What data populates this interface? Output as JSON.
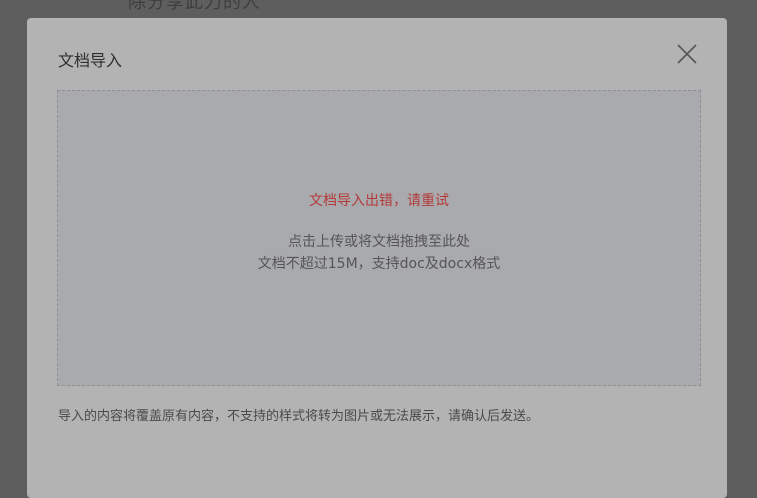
{
  "background": {
    "partial_text": "除分享此力的人"
  },
  "modal": {
    "title": "文档导入",
    "close_icon": "close-icon",
    "dropzone": {
      "error_message": "文档导入出错，请重试",
      "hint_line_1": "点击上传或将文档拖拽至此处",
      "hint_line_2": "文档不超过15M，支持doc及docx格式"
    },
    "notice": "导入的内容将覆盖原有内容，不支持的样式将转为图片或无法展示，请确认后发送。"
  },
  "colors": {
    "overlay": "#5e5e5e",
    "modal_bg": "#b3b3b3",
    "dropzone_bg": "#a9aaad",
    "error": "#b43a3a"
  }
}
